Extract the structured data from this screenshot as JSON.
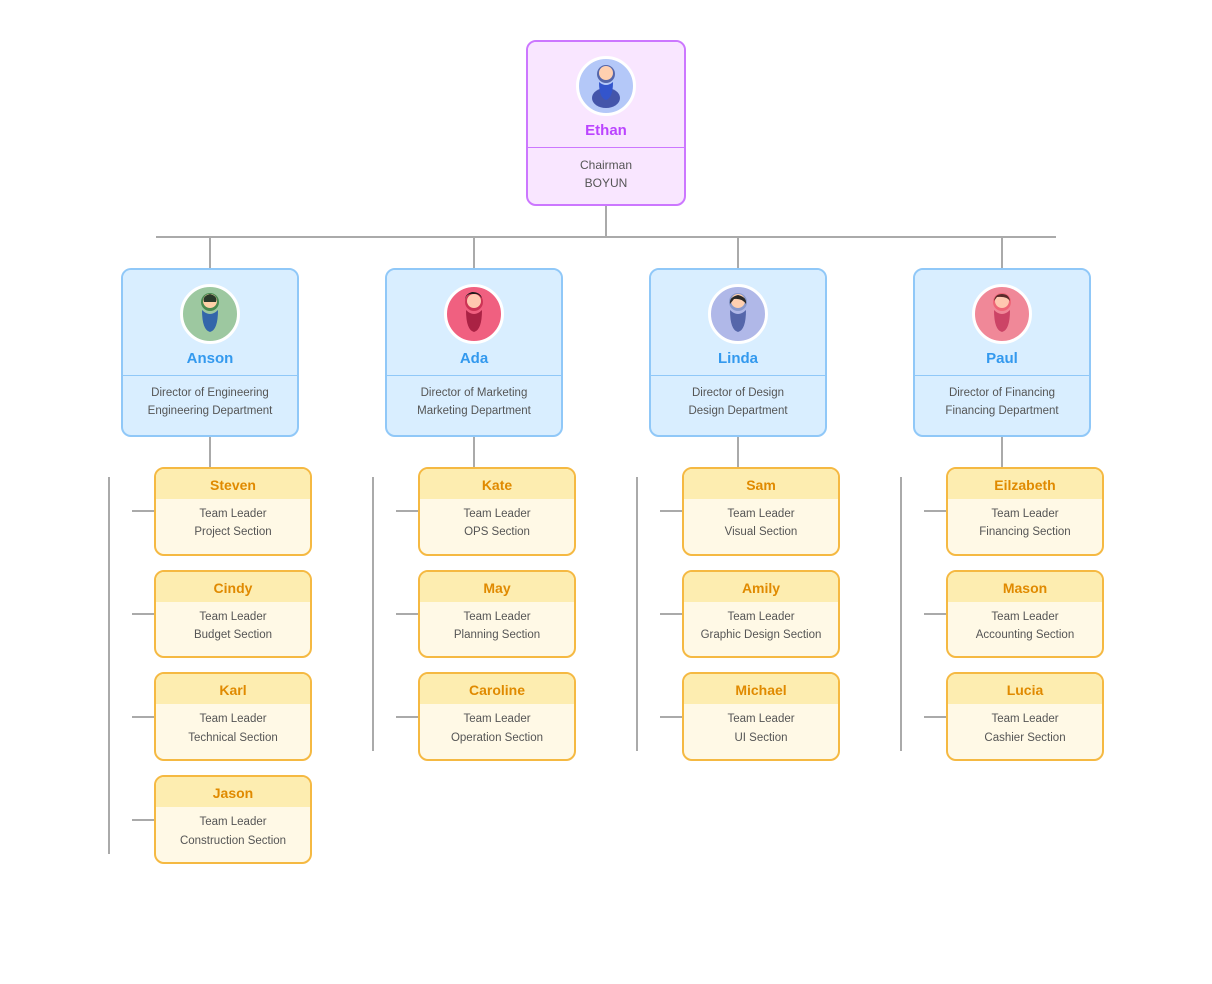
{
  "ceo": {
    "name": "Ethan",
    "title": "Chairman",
    "org": "BOYUN",
    "avatar_color": "#b4c8f8"
  },
  "directors": [
    {
      "id": "anson",
      "name": "Anson",
      "title": "Director of Engineering",
      "dept": "Engineering Department",
      "avatar_color": "#9dc8a0",
      "teams": [
        {
          "name": "Steven",
          "role": "Team Leader",
          "section": "Project Section"
        },
        {
          "name": "Cindy",
          "role": "Team Leader",
          "section": "Budget Section"
        },
        {
          "name": "Karl",
          "role": "Team Leader",
          "section": "Technical Section"
        },
        {
          "name": "Jason",
          "role": "Team Leader",
          "section": "Construction Section"
        }
      ]
    },
    {
      "id": "ada",
      "name": "Ada",
      "title": "Director of Marketing",
      "dept": "Marketing Department",
      "avatar_color": "#f06080",
      "teams": [
        {
          "name": "Kate",
          "role": "Team Leader",
          "section": "OPS Section"
        },
        {
          "name": "May",
          "role": "Team Leader",
          "section": "Planning Section"
        },
        {
          "name": "Caroline",
          "role": "Team Leader",
          "section": "Operation Section"
        }
      ]
    },
    {
      "id": "linda",
      "name": "Linda",
      "title": "Director of Design",
      "dept": "Design Department",
      "avatar_color": "#b0b8e8",
      "teams": [
        {
          "name": "Sam",
          "role": "Team Leader",
          "section": "Visual Section"
        },
        {
          "name": "Amily",
          "role": "Team Leader",
          "section": "Graphic Design Section"
        },
        {
          "name": "Michael",
          "role": "Team Leader",
          "section": "UI Section"
        }
      ]
    },
    {
      "id": "paul",
      "name": "Paul",
      "title": "Director of Financing",
      "dept": "Financing Department",
      "avatar_color": "#f08898",
      "teams": [
        {
          "name": "Eilzabeth",
          "role": "Team Leader",
          "section": "Financing Section"
        },
        {
          "name": "Mason",
          "role": "Team Leader",
          "section": "Accounting Section"
        },
        {
          "name": "Lucia",
          "role": "Team Leader",
          "section": "Cashier Section"
        }
      ]
    }
  ],
  "labels": {
    "chairman": "Chairman",
    "boyun": "BOYUN"
  }
}
